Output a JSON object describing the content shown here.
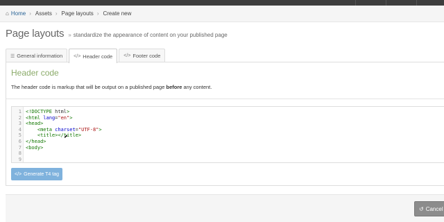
{
  "breadcrumb": {
    "items": [
      "Home",
      "Assets",
      "Page layouts",
      "Create new"
    ]
  },
  "page": {
    "title": "Page layouts",
    "subtitle_marker": "»",
    "subtitle": "standardize the appearance of content on your published page"
  },
  "tabs": [
    {
      "label": "General information",
      "icon": "sliders-icon",
      "active": false
    },
    {
      "label": "Header code",
      "icon": "code-icon",
      "active": true
    },
    {
      "label": "Footer code",
      "icon": "code-icon",
      "active": false
    }
  ],
  "panel": {
    "title": "Header code",
    "desc_before": "The header code is markup that will be output on a published page ",
    "desc_bold": "before",
    "desc_after": " any content."
  },
  "editor": {
    "lines": [
      {
        "num": "1",
        "text": "<!DOCTYPE html>"
      },
      {
        "num": "2",
        "text": "<html lang=\"en\">"
      },
      {
        "num": "3",
        "text": "<head>"
      },
      {
        "num": "4",
        "text": "    <meta charset=\"UTF-8\">"
      },
      {
        "num": "5",
        "text": "    <title></title>"
      },
      {
        "num": "6",
        "text": "</head>"
      },
      {
        "num": "7",
        "text": "<body>"
      },
      {
        "num": "8",
        "text": ""
      },
      {
        "num": "9",
        "text": ""
      }
    ]
  },
  "buttons": {
    "generate": "Generate T4 tag",
    "cancel": "Cancel"
  },
  "colors": {
    "panel_title": "#8bab6a",
    "generate_button": "#7fb2dd",
    "cancel_button": "#8c8c8c",
    "link": "#2a6496"
  }
}
